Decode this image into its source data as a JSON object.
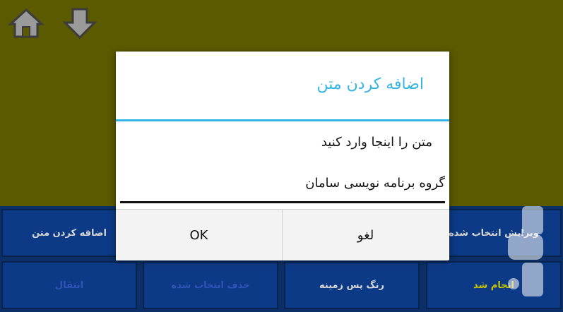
{
  "toolbar": {
    "home_icon": "home-icon",
    "download_icon": "arrow-down-icon"
  },
  "buttons": [
    {
      "label": "اضافه کردن متن",
      "color": "#d7d7d7"
    },
    {
      "label": "ویرایش انتخاب شده",
      "color": "#d7d7d7"
    },
    {
      "label": "انتقال",
      "color": "#2e55b8"
    },
    {
      "label": "حذف انتخاب شده",
      "color": "#2e55b8"
    },
    {
      "label": "رنگ پس زمینه",
      "color": "#d7d7d7"
    },
    {
      "label": "انجام شد",
      "color": "#c9c400"
    }
  ],
  "dialog": {
    "title": "اضافه کردن متن",
    "message": "متن را اینجا وارد کنید",
    "input_value": "گروه برنامه نویسی سامان",
    "ok_label": "OK",
    "cancel_label": "لغو",
    "accent_color": "#33b5e5"
  }
}
